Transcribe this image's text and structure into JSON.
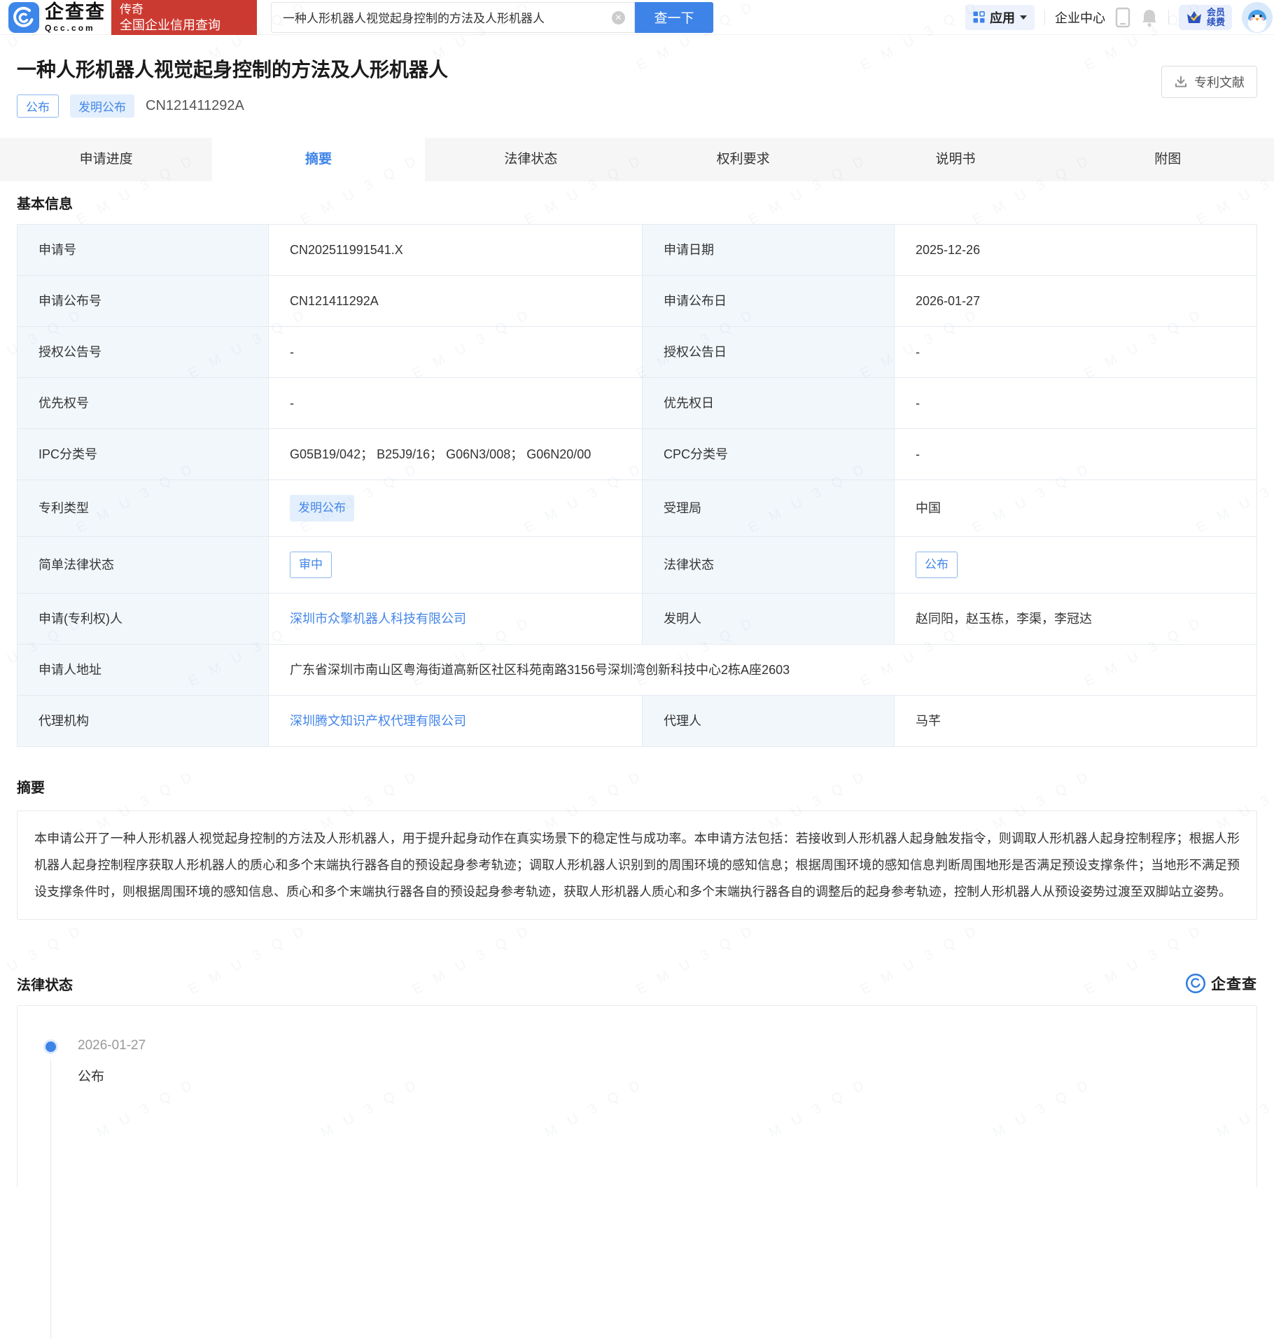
{
  "header": {
    "logo": {
      "name_cn": "企查查",
      "name_en": "Qcc.com"
    },
    "promo": {
      "line1": "传奇",
      "line2": "全国企业信用查询"
    },
    "search": {
      "value": "一种人形机器人视觉起身控制的方法及人形机器人",
      "button": "查一下"
    },
    "nav": {
      "apps": "应用",
      "enterprise_center": "企业中心",
      "vip_line1": "会员",
      "vip_line2": "续费"
    }
  },
  "patent": {
    "title": "一种人形机器人视觉起身控制的方法及人形机器人",
    "status_badge": "公布",
    "type_badge": "发明公布",
    "publication_no": "CN121411292A",
    "download_button": "专利文献"
  },
  "tabs": [
    {
      "label": "申请进度",
      "active": false
    },
    {
      "label": "摘要",
      "active": true
    },
    {
      "label": "法律状态",
      "active": false
    },
    {
      "label": "权利要求",
      "active": false
    },
    {
      "label": "说明书",
      "active": false
    },
    {
      "label": "附图",
      "active": false
    }
  ],
  "basic_info": {
    "heading": "基本信息",
    "rows": [
      [
        {
          "kind": "label",
          "value": "申请号"
        },
        {
          "kind": "text",
          "value": "CN202511991541.X"
        },
        {
          "kind": "label",
          "value": "申请日期"
        },
        {
          "kind": "text",
          "value": "2025-12-26"
        }
      ],
      [
        {
          "kind": "label",
          "value": "申请公布号"
        },
        {
          "kind": "text",
          "value": "CN121411292A"
        },
        {
          "kind": "label",
          "value": "申请公布日"
        },
        {
          "kind": "text",
          "value": "2026-01-27"
        }
      ],
      [
        {
          "kind": "label",
          "value": "授权公告号"
        },
        {
          "kind": "text",
          "value": "-"
        },
        {
          "kind": "label",
          "value": "授权公告日"
        },
        {
          "kind": "text",
          "value": "-"
        }
      ],
      [
        {
          "kind": "label",
          "value": "优先权号"
        },
        {
          "kind": "text",
          "value": "-"
        },
        {
          "kind": "label",
          "value": "优先权日"
        },
        {
          "kind": "text",
          "value": "-"
        }
      ],
      [
        {
          "kind": "label",
          "value": "IPC分类号"
        },
        {
          "kind": "text",
          "value": "G05B19/042； B25J9/16； G06N3/008； G06N20/00"
        },
        {
          "kind": "label",
          "value": "CPC分类号"
        },
        {
          "kind": "text",
          "value": "-"
        }
      ],
      [
        {
          "kind": "label",
          "value": "专利类型"
        },
        {
          "kind": "badge_fill",
          "value": "发明公布"
        },
        {
          "kind": "label",
          "value": "受理局"
        },
        {
          "kind": "text",
          "value": "中国"
        }
      ],
      [
        {
          "kind": "label",
          "value": "简单法律状态"
        },
        {
          "kind": "badge_outline",
          "value": "审中"
        },
        {
          "kind": "label",
          "value": "法律状态"
        },
        {
          "kind": "badge_outline",
          "value": "公布"
        }
      ],
      [
        {
          "kind": "label",
          "value": "申请(专利权)人"
        },
        {
          "kind": "link",
          "value": "深圳市众擎机器人科技有限公司"
        },
        {
          "kind": "label",
          "value": "发明人"
        },
        {
          "kind": "text",
          "value": "赵同阳，赵玉栋，李渠，李冠达"
        }
      ],
      [
        {
          "kind": "label",
          "value": "申请人地址"
        },
        {
          "kind": "text",
          "span": 3,
          "value": "广东省深圳市南山区粤海街道高新区社区科苑南路3156号深圳湾创新科技中心2栋A座2603"
        }
      ],
      [
        {
          "kind": "label",
          "value": "代理机构"
        },
        {
          "kind": "link",
          "value": "深圳腾文知识产权代理有限公司"
        },
        {
          "kind": "label",
          "value": "代理人"
        },
        {
          "kind": "text",
          "value": "马芊"
        }
      ]
    ]
  },
  "abstract": {
    "heading": "摘要",
    "text": "本申请公开了一种人形机器人视觉起身控制的方法及人形机器人，用于提升起身动作在真实场景下的稳定性与成功率。本申请方法包括：若接收到人形机器人起身触发指令，则调取人形机器人起身控制程序；根据人形机器人起身控制程序获取人形机器人的质心和多个末端执行器各自的预设起身参考轨迹；调取人形机器人识别到的周围环境的感知信息；根据周围环境的感知信息判断周围地形是否满足预设支撑条件；当地形不满足预设支撑条件时，则根据周围环境的感知信息、质心和多个末端执行器各自的预设起身参考轨迹，获取人形机器人质心和多个末端执行器各自的调整后的起身参考轨迹，控制人形机器人从预设姿势过渡至双脚站立姿势。"
  },
  "legal_status": {
    "heading": "法律状态",
    "logo_text": "企查查",
    "timeline": [
      {
        "date": "2026-01-27",
        "event": "公布"
      }
    ]
  },
  "watermark": "E M U 3 Q D",
  "colors": {
    "accent": "#3e83e8",
    "link": "#4285e8",
    "promo_red": "#cb3a31",
    "label_bg": "#f2f7fb"
  }
}
